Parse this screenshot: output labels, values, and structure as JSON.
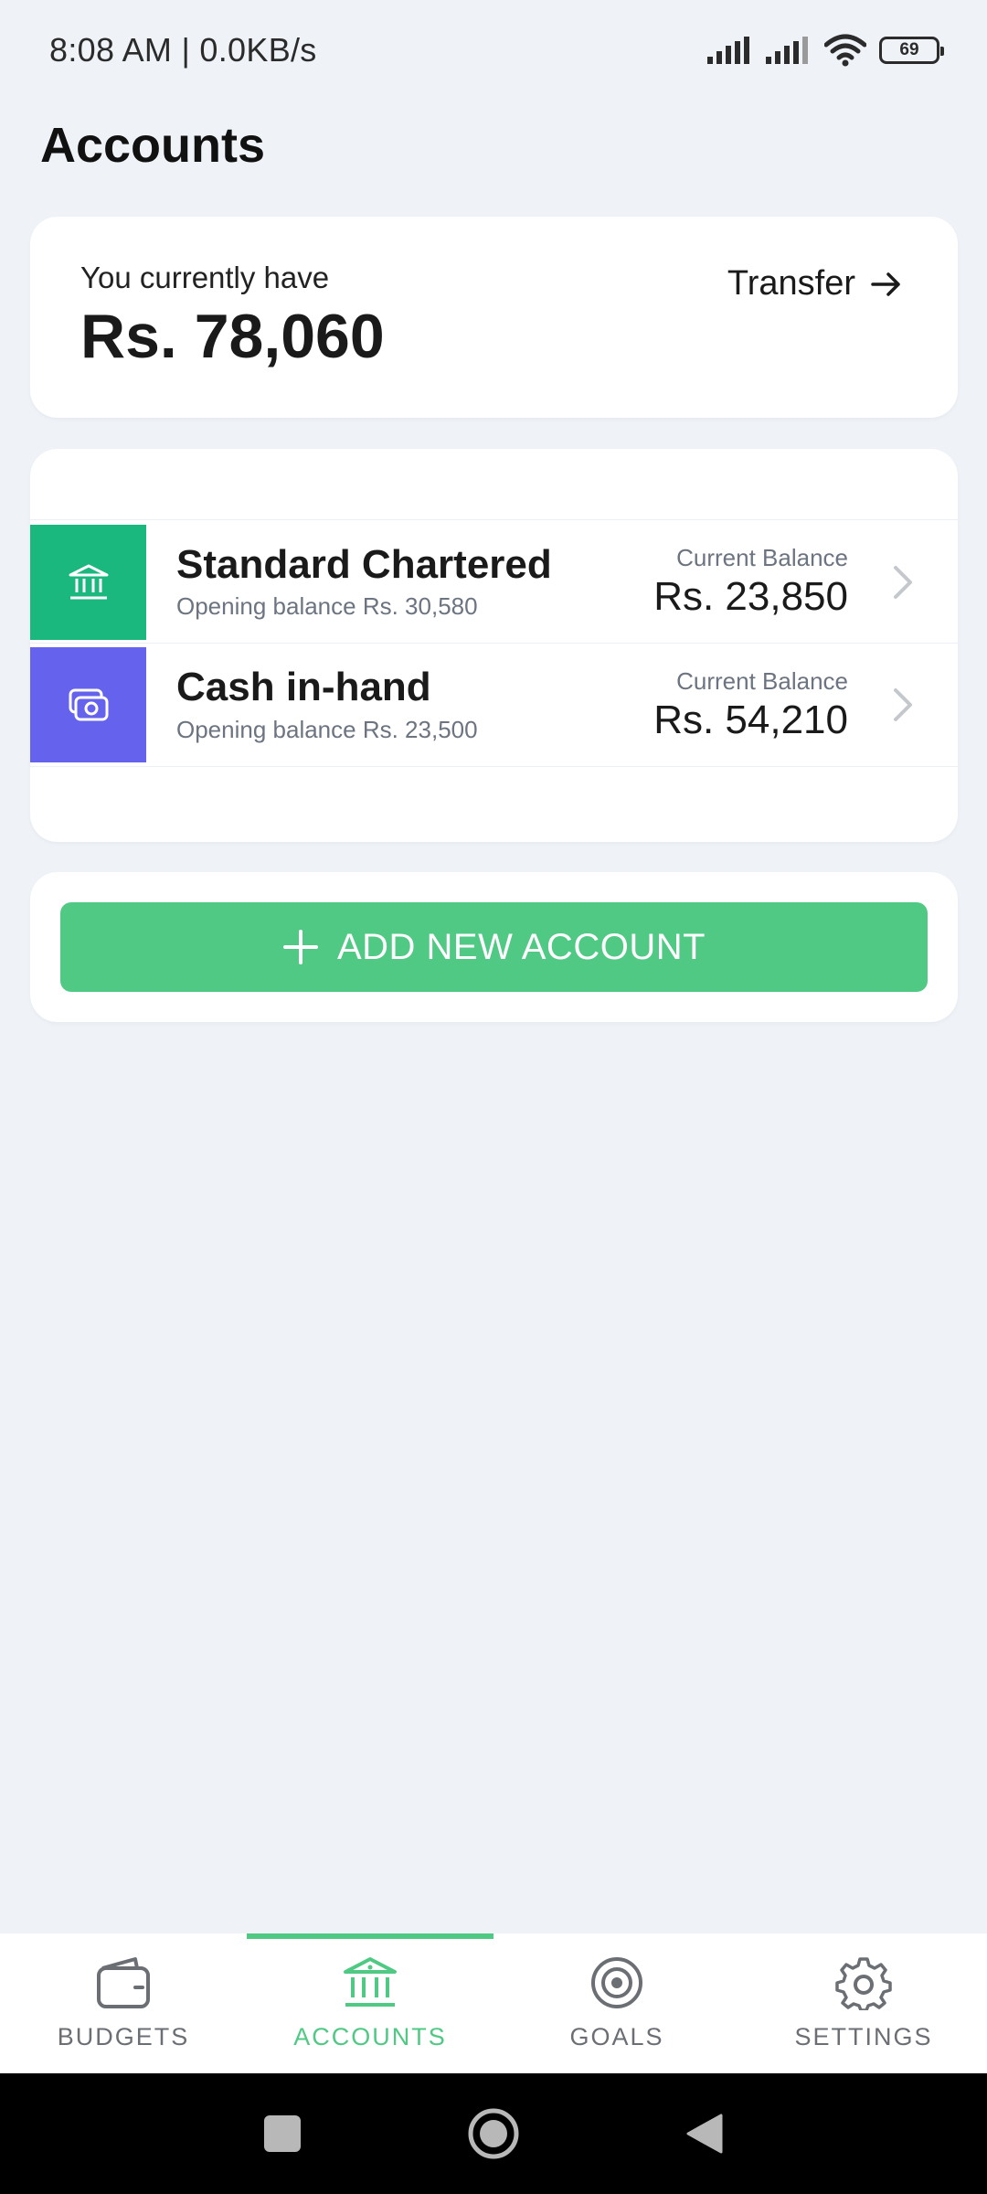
{
  "status_bar": {
    "time": "8:08 AM | 0.0KB/s",
    "battery": "69"
  },
  "page": {
    "title": "Accounts"
  },
  "summary": {
    "label": "You currently have",
    "amount": "Rs. 78,060",
    "transfer_label": "Transfer"
  },
  "accounts": [
    {
      "name": "Standard Chartered",
      "opening": "Opening balance Rs. 30,580",
      "balance_label": "Current Balance",
      "balance": "Rs. 23,850",
      "icon": "bank-icon",
      "color": "#1ab77f"
    },
    {
      "name": "Cash in-hand",
      "opening": "Opening balance Rs. 23,500",
      "balance_label": "Current Balance",
      "balance": "Rs. 54,210",
      "icon": "cash-icon",
      "color": "#6562ee"
    }
  ],
  "add_account": {
    "label": "ADD NEW ACCOUNT"
  },
  "bottom_nav": {
    "items": [
      {
        "label": "BUDGETS",
        "icon": "wallet-icon",
        "active": false
      },
      {
        "label": "ACCOUNTS",
        "icon": "bank-icon",
        "active": true
      },
      {
        "label": "GOALS",
        "icon": "target-icon",
        "active": false
      },
      {
        "label": "SETTINGS",
        "icon": "gear-icon",
        "active": false
      }
    ]
  },
  "colors": {
    "accent": "#4fc983",
    "background": "#eff3f8"
  }
}
